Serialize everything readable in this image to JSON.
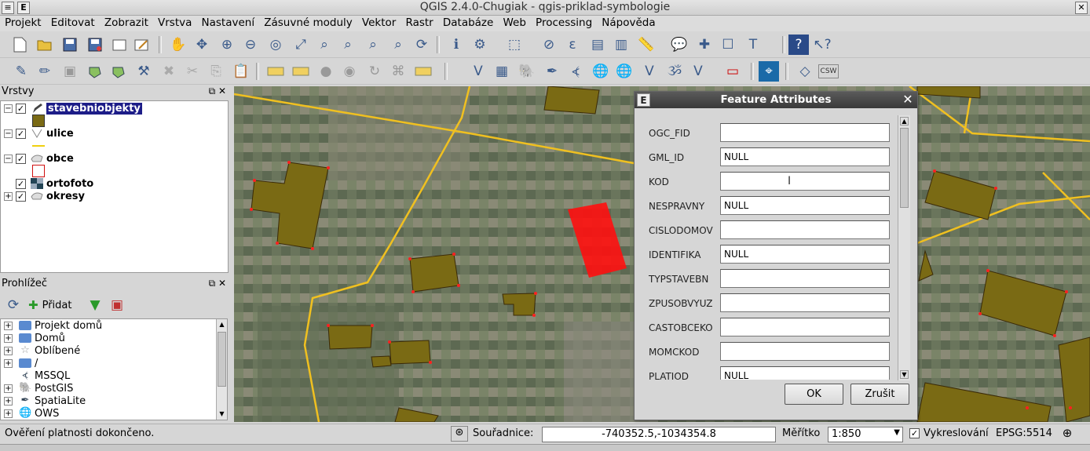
{
  "window": {
    "title": "QGIS 2.4.0-Chugiak - qgis-priklad-symbologie",
    "menu_icon": "≡",
    "app_icon": "E",
    "close": "✕"
  },
  "menu": [
    "Projekt",
    "Editovat",
    "Zobrazit",
    "Vrstva",
    "Nastavení",
    "Zásuvné moduly",
    "Vektor",
    "Rastr",
    "Databáze",
    "Web",
    "Processing",
    "Nápověda"
  ],
  "layers_panel": {
    "title": "Vrstvy",
    "layers": [
      {
        "name": "stavebniobjekty",
        "checked": true,
        "selected": true,
        "expanded": true,
        "symbol_color": "#7a6a14"
      },
      {
        "name": "ulice",
        "checked": true,
        "expanded": true,
        "symbol_color": "#f0d010"
      },
      {
        "name": "obce",
        "checked": true,
        "expanded": true,
        "symbol_color": "#d01010"
      },
      {
        "name": "ortofoto",
        "checked": true,
        "expanded": false
      },
      {
        "name": "okresy",
        "checked": true,
        "expanded": false
      }
    ]
  },
  "browser_panel": {
    "title": "Prohlížeč",
    "add_label": "Přidat",
    "items": [
      "Projekt domů",
      "Domů",
      "Oblíbené",
      "/",
      "MSSQL",
      "PostGIS",
      "SpatiaLite",
      "OWS"
    ]
  },
  "dialog": {
    "title": "Feature Attributes",
    "fields": [
      {
        "label": "OGC_FID",
        "value": ""
      },
      {
        "label": "GML_ID",
        "value": "NULL"
      },
      {
        "label": "KOD",
        "value": ""
      },
      {
        "label": "NESPRAVNY",
        "value": "NULL"
      },
      {
        "label": "CISLODOMOV",
        "value": ""
      },
      {
        "label": "IDENTIFIKA",
        "value": "NULL"
      },
      {
        "label": "TYPSTAVEBN",
        "value": ""
      },
      {
        "label": "ZPUSOBVYUZ",
        "value": ""
      },
      {
        "label": "CASTOBCEKO",
        "value": ""
      },
      {
        "label": "MOMCKOD",
        "value": ""
      },
      {
        "label": "PLATIOD",
        "value": "NULL"
      }
    ],
    "ok_label": "OK",
    "cancel_label": "Zrušit"
  },
  "statusbar": {
    "message": "Ověření platnosti dokončeno.",
    "coord_label": "Souřadnice:",
    "coord_value": "-740352.5,-1034354.8",
    "scale_label": "Měřítko",
    "scale_value": "1:850",
    "render_label": "Vykreslování",
    "render_checked": true,
    "crs": "EPSG:5514"
  },
  "colors": {
    "building_fill": "#7a6a14",
    "road": "#f0c020",
    "highlight": "#ff1010",
    "selection": "#1d1d88"
  }
}
